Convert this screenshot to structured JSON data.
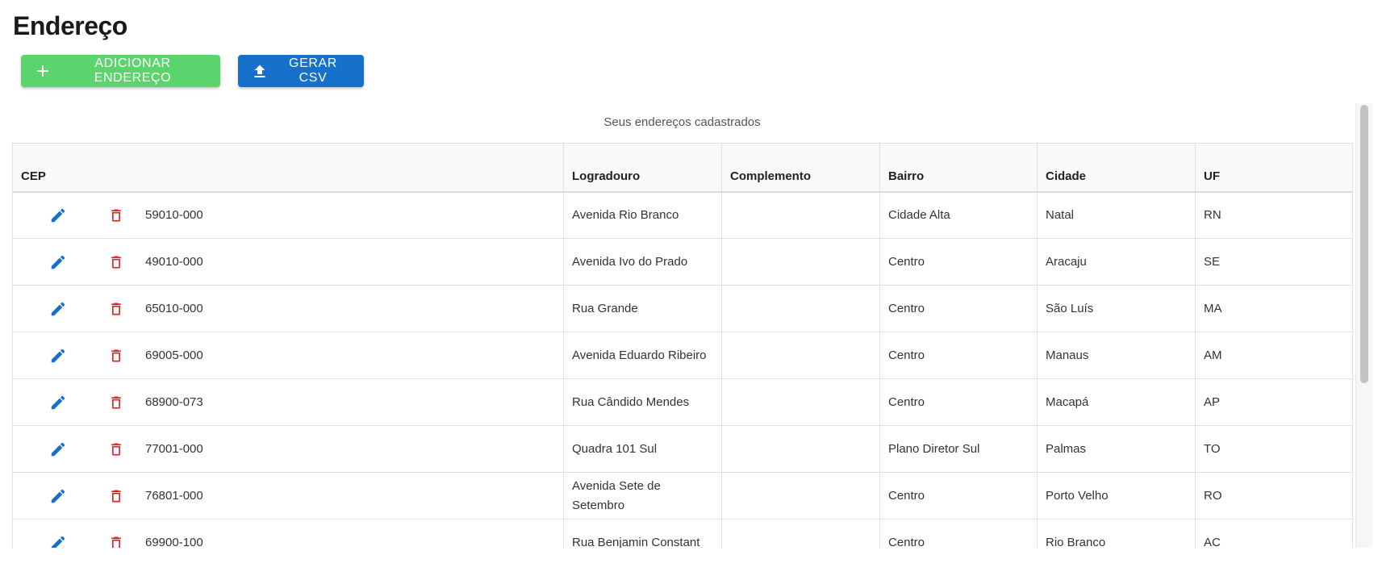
{
  "page": {
    "title": "Endereço"
  },
  "toolbar": {
    "add_label": "ADICIONAR ENDEREÇO",
    "add_icon": "plus-icon",
    "add_color": "#5cd46d",
    "csv_label": "GERAR CSV",
    "csv_icon": "upload-icon",
    "csv_color": "#1771cc"
  },
  "table": {
    "caption": "Seus endereços cadastrados",
    "columns": [
      "CEP",
      "Logradouro",
      "Complemento",
      "Bairro",
      "Cidade",
      "UF"
    ],
    "row_actions": {
      "edit_icon": "pencil-icon",
      "edit_color": "#1771cc",
      "delete_icon": "trash-icon",
      "delete_color": "#ee1c25"
    },
    "rows": [
      {
        "cep": "59010-000",
        "logradouro": "Avenida Rio Branco",
        "complemento": "",
        "bairro": "Cidade Alta",
        "cidade": "Natal",
        "uf": "RN"
      },
      {
        "cep": "49010-000",
        "logradouro": "Avenida Ivo do Prado",
        "complemento": "",
        "bairro": "Centro",
        "cidade": "Aracaju",
        "uf": "SE"
      },
      {
        "cep": "65010-000",
        "logradouro": "Rua Grande",
        "complemento": "",
        "bairro": "Centro",
        "cidade": "São Luís",
        "uf": "MA"
      },
      {
        "cep": "69005-000",
        "logradouro": "Avenida Eduardo Ribeiro",
        "complemento": "",
        "bairro": "Centro",
        "cidade": "Manaus",
        "uf": "AM"
      },
      {
        "cep": "68900-073",
        "logradouro": "Rua Cândido Mendes",
        "complemento": "",
        "bairro": "Centro",
        "cidade": "Macapá",
        "uf": "AP"
      },
      {
        "cep": "77001-000",
        "logradouro": "Quadra 101 Sul",
        "complemento": "",
        "bairro": "Plano Diretor Sul",
        "cidade": "Palmas",
        "uf": "TO"
      },
      {
        "cep": "76801-000",
        "logradouro": "Avenida Sete de Setembro",
        "complemento": "",
        "bairro": "Centro",
        "cidade": "Porto Velho",
        "uf": "RO"
      },
      {
        "cep": "69900-100",
        "logradouro": "Rua Benjamin Constant",
        "complemento": "",
        "bairro": "Centro",
        "cidade": "Rio Branco",
        "uf": "AC"
      }
    ]
  }
}
